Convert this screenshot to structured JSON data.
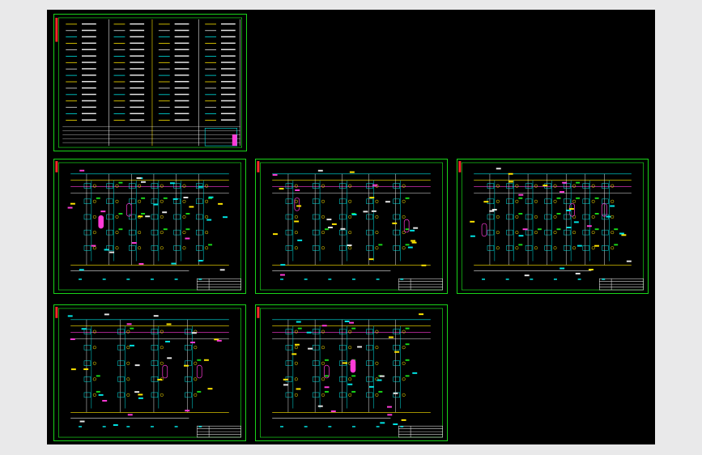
{
  "workspace": {
    "background": "#000000",
    "frame_color": "#19d419"
  },
  "sheets": [
    {
      "id": "legend-sheet",
      "kind": "legend"
    },
    {
      "id": "pid-sheet-1",
      "kind": "pid"
    },
    {
      "id": "pid-sheet-2",
      "kind": "pid"
    },
    {
      "id": "pid-sheet-3",
      "kind": "pid"
    },
    {
      "id": "pid-sheet-4",
      "kind": "pid"
    },
    {
      "id": "pid-sheet-5",
      "kind": "pid"
    }
  ],
  "colors": {
    "line_cyan": "#00e5e5",
    "line_yellow": "#ffe600",
    "line_magenta": "#ff3bd8",
    "line_white": "#e6e6e6",
    "line_red": "#ff2a2a",
    "line_green": "#19d419"
  }
}
